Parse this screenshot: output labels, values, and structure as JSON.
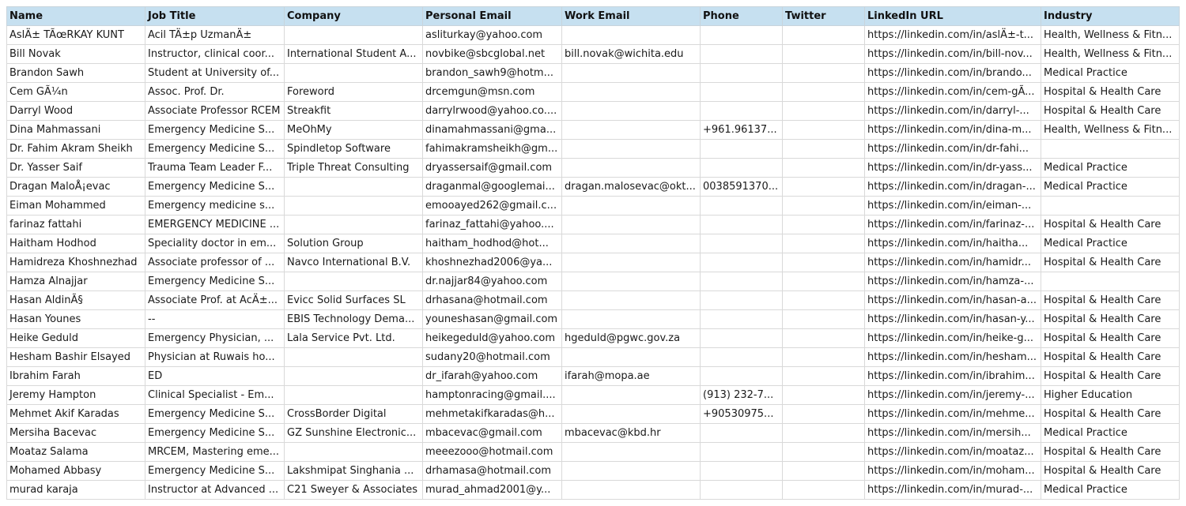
{
  "table": {
    "columns": [
      "Name",
      "Job Title",
      "Company",
      "Personal Email",
      "Work Email",
      "Phone",
      "Twitter",
      "LinkedIn URL",
      "Industry"
    ],
    "rows": [
      [
        "AslÄ± TÃœRKAY KUNT",
        "Acil TÄ±p UzmanÄ±",
        "",
        "asliturkay@yahoo.com",
        "",
        "",
        "",
        "https://linkedin.com/in/aslÄ±-t...",
        "Health, Wellness & Fitn..."
      ],
      [
        "Bill Novak",
        "Instructor, clinical coor...",
        "International Student A...",
        "novbike@sbcglobal.net",
        "bill.novak@wichita.edu",
        "",
        "",
        "https://linkedin.com/in/bill-nov...",
        "Health, Wellness & Fitn..."
      ],
      [
        "Brandon Sawh",
        "Student at University of...",
        "",
        "brandon_sawh9@hotm...",
        "",
        "",
        "",
        "https://linkedin.com/in/brando...",
        "Medical Practice"
      ],
      [
        "Cem GÃ¼n",
        "Assoc. Prof. Dr.",
        "Foreword",
        "drcemgun@msn.com",
        "",
        "",
        "",
        "https://linkedin.com/in/cem-gÃ...",
        "Hospital & Health Care"
      ],
      [
        "Darryl Wood",
        "Associate Professor RCEM",
        "Streakfit",
        "darrylrwood@yahoo.co....",
        "",
        "",
        "",
        "https://linkedin.com/in/darryl-...",
        "Hospital & Health Care"
      ],
      [
        "Dina Mahmassani",
        "Emergency Medicine S...",
        "MeOhMy",
        "dinamahmassani@gma...",
        "",
        "+961.96137...",
        "",
        "https://linkedin.com/in/dina-m...",
        "Health, Wellness & Fitn..."
      ],
      [
        "Dr. Fahim Akram Sheikh",
        "Emergency Medicine S...",
        "Spindletop Software",
        "fahimakramsheikh@gm...",
        "",
        "",
        "",
        "https://linkedin.com/in/dr-fahi...",
        ""
      ],
      [
        "Dr. Yasser Saif",
        "Trauma Team Leader F...",
        "Triple Threat Consulting",
        "dryassersaif@gmail.com",
        "",
        "",
        "",
        "https://linkedin.com/in/dr-yass...",
        "Medical Practice"
      ],
      [
        "Dragan MaloÅ¡evac",
        "Emergency Medicine S...",
        "",
        "draganmal@googlemai...",
        "dragan.malosevac@okt...",
        "0038591370...",
        "",
        "https://linkedin.com/in/dragan-...",
        "Medical Practice"
      ],
      [
        "Eiman Mohammed",
        "Emergency medicine s...",
        "",
        "emooayed262@gmail.c...",
        "",
        "",
        "",
        "https://linkedin.com/in/eiman-...",
        ""
      ],
      [
        "farinaz fattahi",
        "EMERGENCY MEDICINE ...",
        "",
        "farinaz_fattahi@yahoo....",
        "",
        "",
        "",
        "https://linkedin.com/in/farinaz-...",
        "Hospital & Health Care"
      ],
      [
        "Haitham Hodhod",
        "Speciality doctor in em...",
        "Solution Group",
        "haitham_hodhod@hot...",
        "",
        "",
        "",
        "https://linkedin.com/in/haitha...",
        "Medical Practice"
      ],
      [
        "Hamidreza Khoshnezhad",
        "Associate professor of ...",
        "Navco International B.V.",
        "khoshnezhad2006@ya...",
        "",
        "",
        "",
        "https://linkedin.com/in/hamidr...",
        "Hospital & Health Care"
      ],
      [
        "Hamza Alnajjar",
        "Emergency Medicine S...",
        "",
        "dr.najjar84@yahoo.com",
        "",
        "",
        "",
        "https://linkedin.com/in/hamza-...",
        ""
      ],
      [
        "Hasan AldinÃ§",
        "Associate Prof. at AcÄ±...",
        "Evicc Solid Surfaces SL",
        "drhasana@hotmail.com",
        "",
        "",
        "",
        "https://linkedin.com/in/hasan-a...",
        "Hospital & Health Care"
      ],
      [
        "Hasan Younes",
        "--",
        "EBIS Technology Dema...",
        "youneshasan@gmail.com",
        "",
        "",
        "",
        "https://linkedin.com/in/hasan-y...",
        "Hospital & Health Care"
      ],
      [
        "Heike Geduld",
        "Emergency Physician, ...",
        "Lala Service Pvt. Ltd.",
        "heikegeduld@yahoo.com",
        "hgeduld@pgwc.gov.za",
        "",
        "",
        "https://linkedin.com/in/heike-g...",
        "Hospital & Health Care"
      ],
      [
        "Hesham Bashir Elsayed",
        "Physician at Ruwais ho...",
        "",
        "sudany20@hotmail.com",
        "",
        "",
        "",
        "https://linkedin.com/in/hesham...",
        "Hospital & Health Care"
      ],
      [
        "Ibrahim Farah",
        "ED",
        "",
        "dr_ifarah@yahoo.com",
        "ifarah@mopa.ae",
        "",
        "",
        "https://linkedin.com/in/ibrahim...",
        "Hospital & Health Care"
      ],
      [
        "Jeremy Hampton",
        "Clinical Specialist - Em...",
        "",
        "hamptonracing@gmail....",
        "",
        "(913) 232-7...",
        "",
        "https://linkedin.com/in/jeremy-...",
        "Higher Education"
      ],
      [
        "Mehmet Akif Karadas",
        "Emergency Medicine S...",
        "CrossBorder Digital",
        "mehmetakifkaradas@h...",
        "",
        "+90530975...",
        "",
        "https://linkedin.com/in/mehme...",
        "Hospital & Health Care"
      ],
      [
        "Mersiha Bacevac",
        "Emergency Medicine S...",
        "GZ Sunshine Electronic...",
        "mbacevac@gmail.com",
        "mbacevac@kbd.hr",
        "",
        "",
        "https://linkedin.com/in/mersih...",
        "Medical Practice"
      ],
      [
        "Moataz Salama",
        "MRCEM, Mastering eme...",
        "",
        "meeezooo@hotmail.com",
        "",
        "",
        "",
        "https://linkedin.com/in/moataz...",
        "Hospital & Health Care"
      ],
      [
        "Mohamed Abbasy",
        "Emergency Medicine S...",
        "Lakshmipat Singhania ...",
        "drhamasa@hotmail.com",
        "",
        "",
        "",
        "https://linkedin.com/in/moham...",
        "Hospital & Health Care"
      ],
      [
        "murad karaja",
        "Instructor at Advanced ...",
        "C21 Sweyer & Associates",
        "murad_ahmad2001@y...",
        "",
        "",
        "",
        "https://linkedin.com/in/murad-...",
        "Medical Practice"
      ]
    ]
  },
  "colors": {
    "header_bg": "#c6e0f0",
    "grid": "#d9d9d9"
  }
}
